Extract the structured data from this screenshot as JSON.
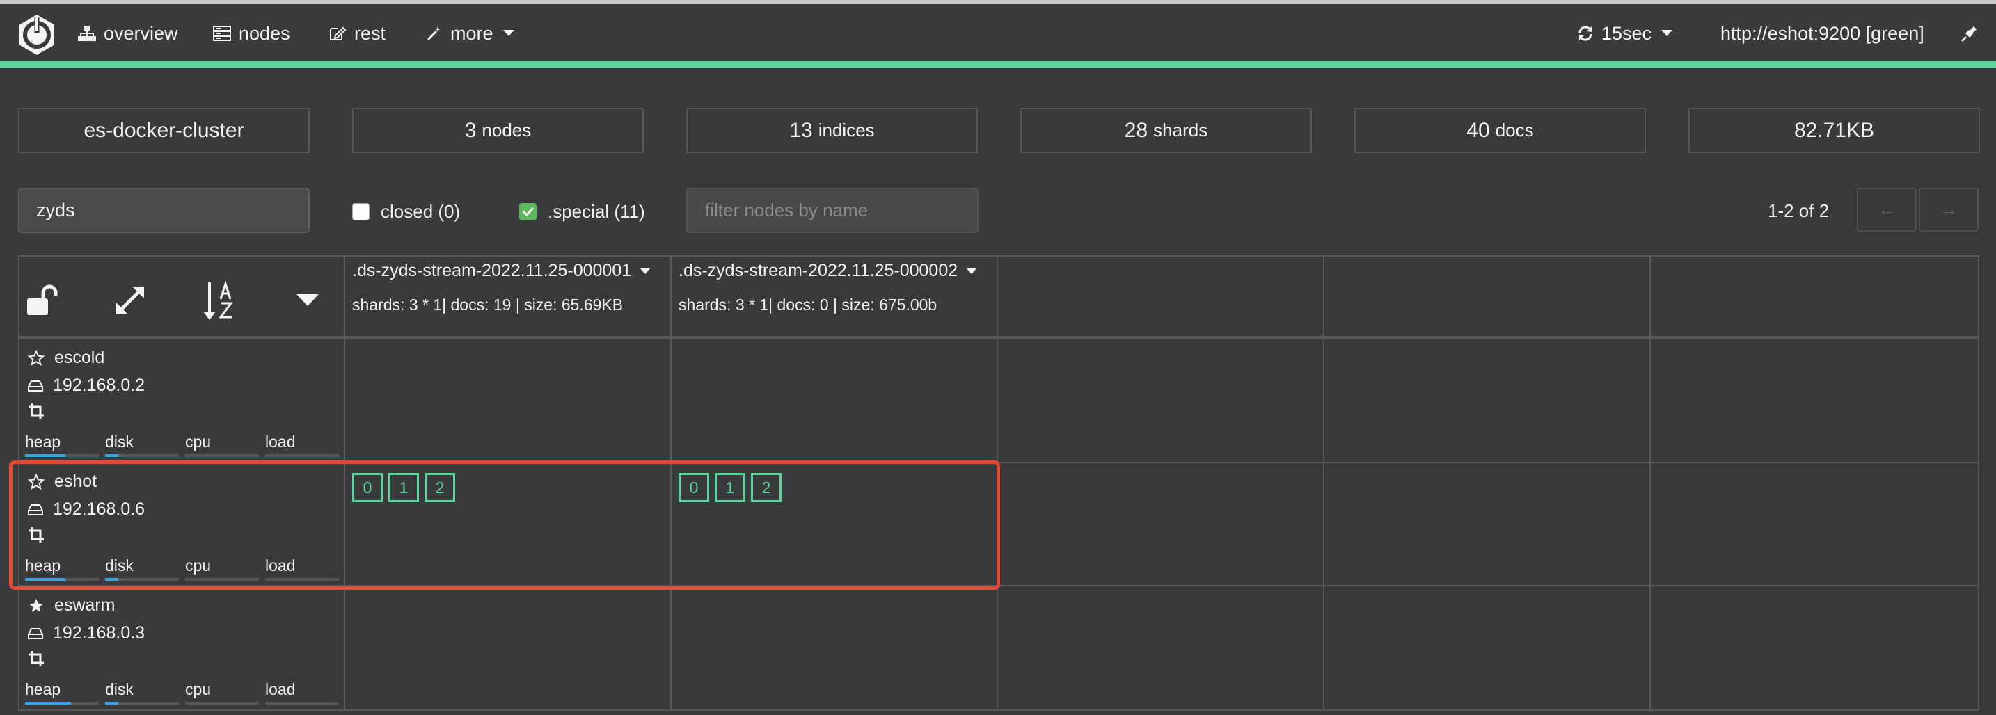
{
  "nav": {
    "overview": "overview",
    "nodes": "nodes",
    "rest": "rest",
    "more": "more",
    "refresh": "15sec",
    "cluster_url": "http://eshot:9200 [green]"
  },
  "stats": {
    "cluster_name": "es-docker-cluster",
    "nodes_count": "3",
    "nodes_label": "nodes",
    "indices_count": "13",
    "indices_label": "indices",
    "shards_count": "28",
    "shards_label": "shards",
    "docs_count": "40",
    "docs_label": "docs",
    "size": "82.71KB"
  },
  "filters": {
    "index_filter_value": "zyds",
    "closed_label": "closed (0)",
    "closed_checked": false,
    "special_label": ".special (11)",
    "special_checked": true,
    "node_filter_placeholder": "filter nodes by name",
    "pager_text": "1-2 of 2",
    "prev_label": "←",
    "next_label": "→"
  },
  "indices": [
    {
      "name": ".ds-zyds-stream-2022.11.25-000001",
      "meta": "shards: 3 * 1| docs: 19 | size: 65.69KB"
    },
    {
      "name": ".ds-zyds-stream-2022.11.25-000002",
      "meta": "shards: 3 * 1| docs: 0 | size: 675.00b"
    }
  ],
  "nodes": [
    {
      "name": "escold",
      "ip": "192.168.0.2",
      "master": false,
      "heap_fill": 0.55,
      "disk_fill": 0.18
    },
    {
      "name": "eshot",
      "ip": "192.168.0.6",
      "master": false,
      "heap_fill": 0.55,
      "disk_fill": 0.18,
      "shards": [
        [
          "0",
          "1",
          "2"
        ],
        [
          "0",
          "1",
          "2"
        ]
      ]
    },
    {
      "name": "eswarm",
      "ip": "192.168.0.3",
      "master": true,
      "heap_fill": 0.62,
      "disk_fill": 0.18
    }
  ],
  "metric_labels": {
    "heap": "heap",
    "disk": "disk",
    "cpu": "cpu",
    "load": "load"
  },
  "colors": {
    "accent_green": "#5dd39e",
    "highlight_red": "#e74733",
    "bar_blue": "#3aa3e3",
    "background": "#393a3c"
  },
  "icons": [
    "cerebro-logo-icon",
    "sitemap-icon",
    "server-icon",
    "edit-icon",
    "magic-wand-icon",
    "caret-down-icon",
    "refresh-icon",
    "plug-icon",
    "unlock-icon",
    "expand-icon",
    "sort-alpha-icon",
    "star-outline-icon",
    "star-icon",
    "hdd-icon",
    "crop-icon"
  ]
}
